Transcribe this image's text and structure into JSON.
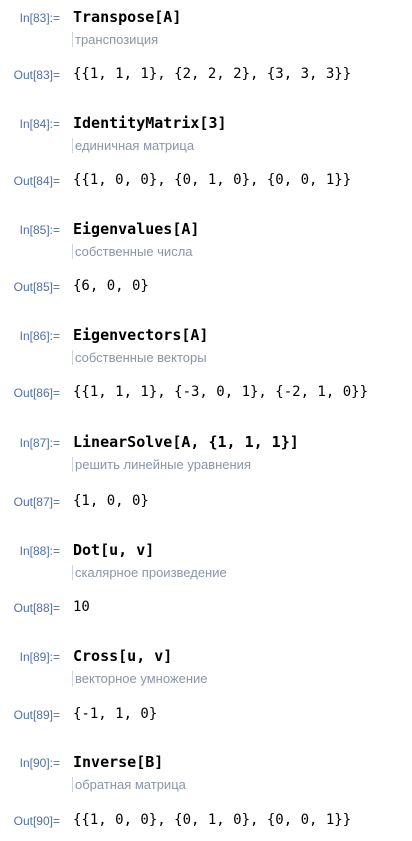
{
  "cells": [
    {
      "in_label": "In[83]:=",
      "input": "Transpose[A]",
      "hint": "транспозиция",
      "out_label": "Out[83]=",
      "output": "{{1, 1, 1}, {2, 2, 2}, {3, 3, 3}}"
    },
    {
      "in_label": "In[84]:=",
      "input": "IdentityMatrix[3]",
      "hint": "единичная матрица",
      "out_label": "Out[84]=",
      "output": "{{1, 0, 0}, {0, 1, 0}, {0, 0, 1}}"
    },
    {
      "in_label": "In[85]:=",
      "input": "Eigenvalues[A]",
      "hint": "собственные числа",
      "out_label": "Out[85]=",
      "output": "{6, 0, 0}"
    },
    {
      "in_label": "In[86]:=",
      "input": "Eigenvectors[A]",
      "hint": "собственные векторы",
      "out_label": "Out[86]=",
      "output": "{{1, 1, 1}, {-3, 0, 1}, {-2, 1, 0}}"
    },
    {
      "in_label": "In[87]:=",
      "input": "LinearSolve[A, {1, 1, 1}]",
      "hint": "решить линейные уравнения",
      "out_label": "Out[87]=",
      "output": "{1, 0, 0}"
    },
    {
      "in_label": "In[88]:=",
      "input": "Dot[u, v]",
      "hint": "скалярное произведение",
      "out_label": "Out[88]=",
      "output": "10"
    },
    {
      "in_label": "In[89]:=",
      "input": "Cross[u, v]",
      "hint": "векторное умножение",
      "out_label": "Out[89]=",
      "output": "{-1, 1, 0}"
    },
    {
      "in_label": "In[90]:=",
      "input": "Inverse[B]",
      "hint": "обратная матрица",
      "out_label": "Out[90]=",
      "output": "{{1, 0, 0}, {0, 1, 0}, {0, 0, 1}}"
    }
  ]
}
